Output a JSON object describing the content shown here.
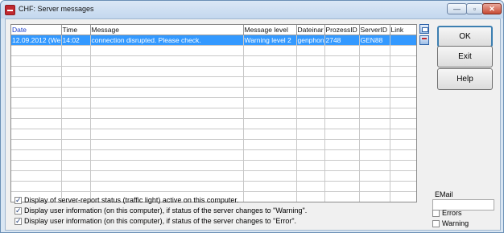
{
  "window": {
    "title": "CHF: Server messages",
    "controls": {
      "minimize": "—",
      "maximize": "▫",
      "close": "✕"
    }
  },
  "table": {
    "columns": [
      "Date",
      "Time",
      "Message",
      "Message level",
      "Dateinar",
      "ProzessID",
      "ServerID",
      "Link"
    ],
    "rows": [
      [
        "12.09.2012 (We",
        "14:02",
        " connection disrupted. Please check.",
        "Warning level 2",
        "genphon",
        "2748",
        "GEN88",
        ""
      ]
    ]
  },
  "buttons": {
    "ok": "OK",
    "exit": "Exit",
    "help": "Help"
  },
  "options": {
    "traffic_light": {
      "label": "Display of server-report status (traffic light) active on this computer.",
      "checked": true
    },
    "warning_info": {
      "label": "Display user information (on this computer), if status of the server changes to \"Warning\".",
      "checked": true
    },
    "error_info": {
      "label": "Display user information (on this computer), if status of the server changes to \"Error\".",
      "checked": true
    }
  },
  "email": {
    "label": "EMail",
    "value": "",
    "errors_label": "Errors",
    "errors_checked": false,
    "warning_label": "Warning",
    "warning_checked": false
  },
  "icons": {
    "app": "app-icon",
    "side1": "view-icon",
    "side2": "table-settings-icon"
  }
}
